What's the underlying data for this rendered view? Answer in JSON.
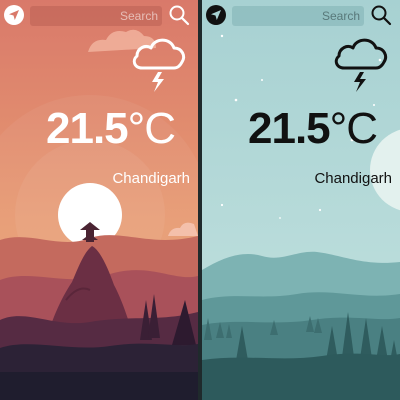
{
  "screens": [
    {
      "theme": "sunset",
      "search": {
        "placeholder": "Search"
      },
      "weather": {
        "condition": "thunderstorm",
        "icon": "cloud-lightning-icon",
        "temperature": "21.5",
        "unit": "°C",
        "city": "Chandigarh"
      },
      "colors": {
        "accent": "#ffffff",
        "sky_top": "#d9796a",
        "sky_bottom": "#e7a072",
        "ground": "#1f1d2e"
      }
    },
    {
      "theme": "teal-night",
      "search": {
        "placeholder": "Search"
      },
      "weather": {
        "condition": "thunderstorm",
        "icon": "cloud-lightning-icon",
        "temperature": "21.5",
        "unit": "°C",
        "city": "Chandigarh"
      },
      "colors": {
        "accent": "#111111",
        "sky_top": "#a9d3d3",
        "sky_bottom": "#bfe0de",
        "ground": "#2d5a5c"
      }
    }
  ]
}
